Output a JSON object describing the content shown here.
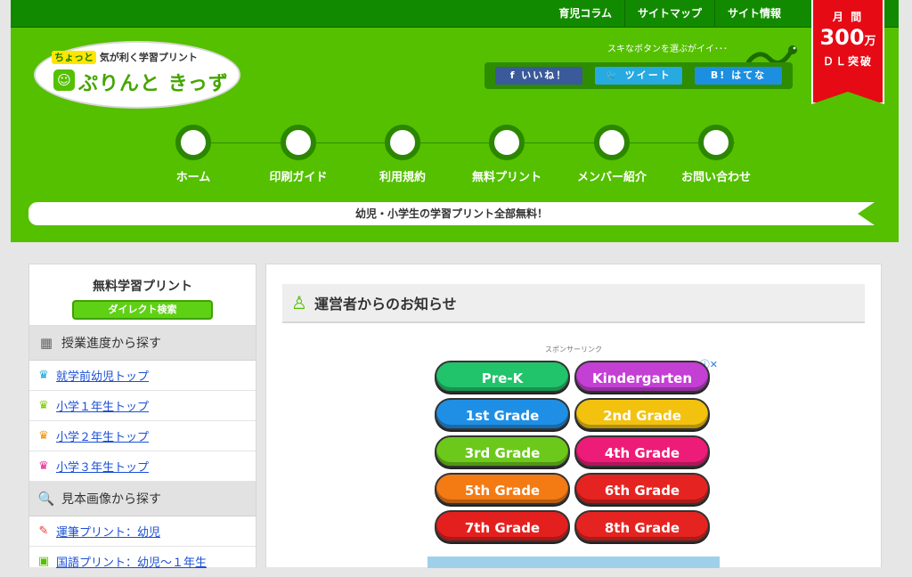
{
  "topnav": [
    "育児コラム",
    "サイトマップ",
    "サイト情報"
  ],
  "dl_badge": {
    "line1": "月 間",
    "number": "300",
    "unit": "万",
    "line3": "ＤＬ突破"
  },
  "logo": {
    "tag_highlight": "ちょっと",
    "tagline": " 気が利く学習プリント",
    "name": "ぷりんと きっず"
  },
  "share": {
    "text": "スキなボタンを選ぶがイイ･･･",
    "facebook": "f いいね！",
    "twitter": "🐦 ツイート",
    "hatena": "B! はてな"
  },
  "mainnav": [
    "ホーム",
    "印刷ガイド",
    "利用規約",
    "無料プリント",
    "メンバー紹介",
    "お問い合わせ"
  ],
  "banner": "幼児・小学生の学習プリント全部無料！",
  "sidebar": {
    "title": "無料学習プリント",
    "direct": "ダイレクト検索",
    "section1": "授業進度から探す",
    "progress_items": [
      {
        "label": "就学前幼児トップ",
        "color": "#1aa7d8"
      },
      {
        "label": "小学１年生トップ",
        "color": "#7bc800"
      },
      {
        "label": "小学２年生トップ",
        "color": "#f29100"
      },
      {
        "label": "小学３年生トップ",
        "color": "#e2248e"
      }
    ],
    "section2": "見本画像から探す",
    "sample_items": [
      {
        "label": "運筆プリント：幼児",
        "color": "#e53b2c"
      },
      {
        "label": "国語プリント：幼児〜１年生",
        "color": "#54c000"
      }
    ]
  },
  "content": {
    "title": "運営者からのお知らせ",
    "sponsor": "スポンサーリンク"
  },
  "ad": {
    "grades": [
      {
        "label": "Pre-K",
        "color": "#21c46a"
      },
      {
        "label": "Kindergarten",
        "color": "#c43fd4"
      },
      {
        "label": "1st Grade",
        "color": "#1f8fe6"
      },
      {
        "label": "2nd Grade",
        "color": "#f2c20f"
      },
      {
        "label": "3rd Grade",
        "color": "#6cc91c"
      },
      {
        "label": "4th Grade",
        "color": "#ec1c78"
      },
      {
        "label": "5th Grade",
        "color": "#f47a14"
      },
      {
        "label": "6th Grade",
        "color": "#e52421"
      },
      {
        "label": "7th Grade",
        "color": "#e4201f"
      },
      {
        "label": "8th Grade",
        "color": "#e52421"
      }
    ]
  }
}
